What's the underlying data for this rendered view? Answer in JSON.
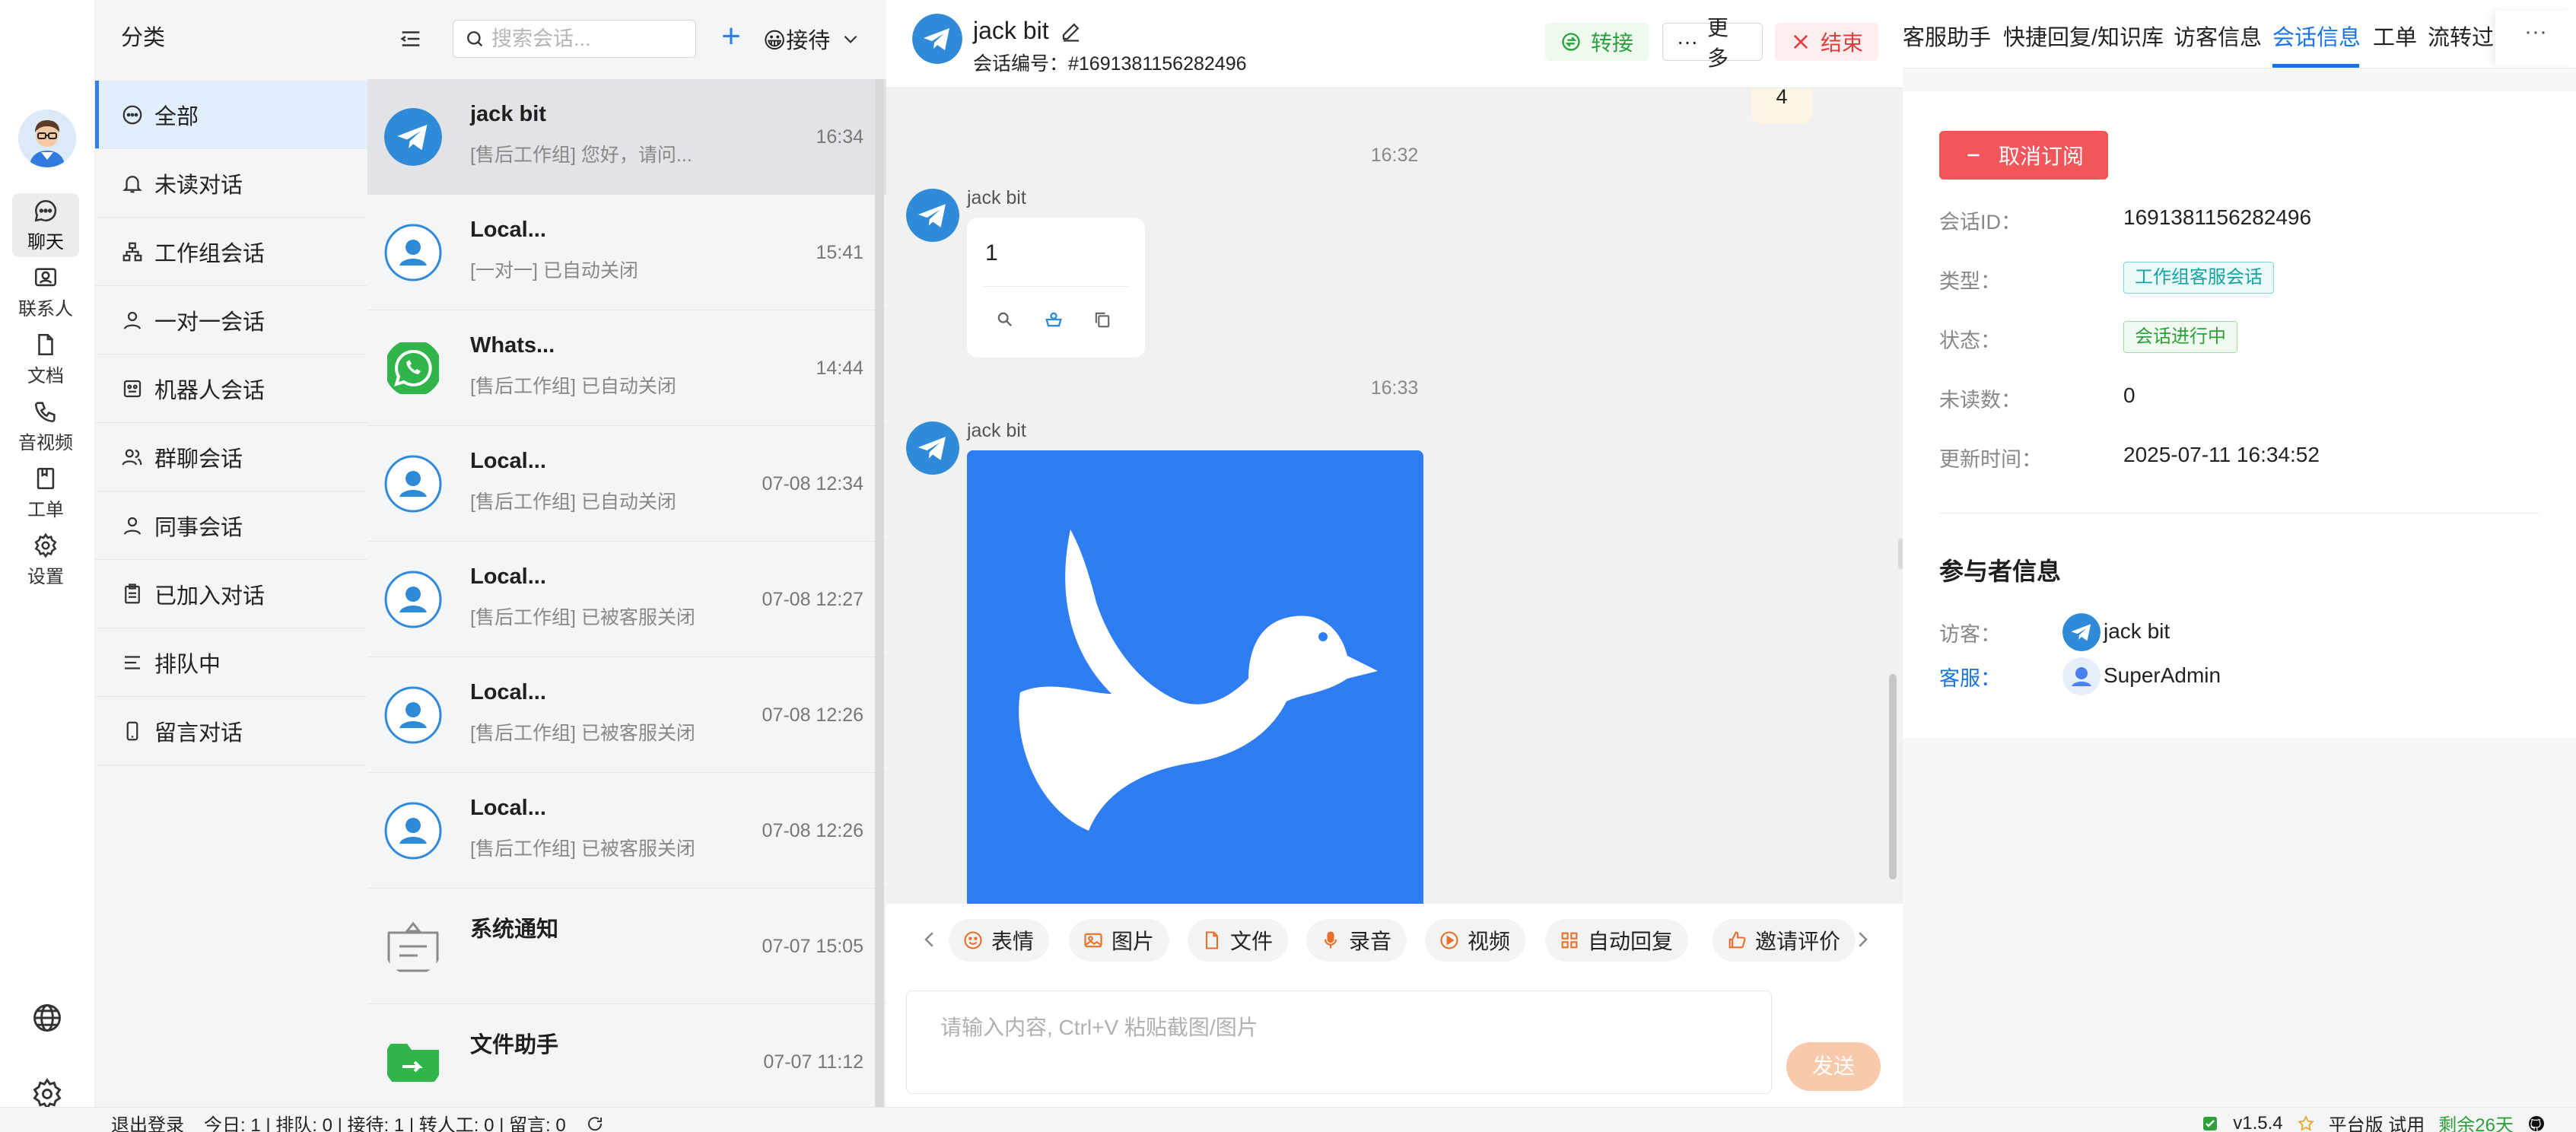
{
  "rail": {
    "items": [
      {
        "label": "聊天"
      },
      {
        "label": "联系人"
      },
      {
        "label": "文档"
      },
      {
        "label": "音视频"
      },
      {
        "label": "工单"
      },
      {
        "label": "设置"
      }
    ]
  },
  "category": {
    "title": "分类",
    "items": [
      {
        "label": "全部"
      },
      {
        "label": "未读对话"
      },
      {
        "label": "工作组会话"
      },
      {
        "label": "一对一会话"
      },
      {
        "label": "机器人会话"
      },
      {
        "label": "群聊会话"
      },
      {
        "label": "同事会话"
      },
      {
        "label": "已加入对话"
      },
      {
        "label": "排队中"
      },
      {
        "label": "留言对话"
      }
    ]
  },
  "conv_header": {
    "search_placeholder": "搜索会话...",
    "receive_label": "😀接待"
  },
  "conversations": [
    {
      "name": "jack bit",
      "preview": "[售后工作组] 您好，请问...",
      "time": "16:34",
      "avatar": "telegram-icon"
    },
    {
      "name": "Local...",
      "preview": "[一对一] 已自动关闭",
      "time": "15:41",
      "avatar": "user-icon"
    },
    {
      "name": "Whats...",
      "preview": "[售后工作组] 已自动关闭",
      "time": "14:44",
      "avatar": "whatsapp-icon"
    },
    {
      "name": "Local...",
      "preview": "[售后工作组] 已自动关闭",
      "time": "07-08 12:34",
      "avatar": "user-icon"
    },
    {
      "name": "Local...",
      "preview": "[售后工作组] 已被客服关闭",
      "time": "07-08 12:27",
      "avatar": "user-icon"
    },
    {
      "name": "Local...",
      "preview": "[售后工作组] 已被客服关闭",
      "time": "07-08 12:26",
      "avatar": "user-icon"
    },
    {
      "name": "Local...",
      "preview": "[售后工作组] 已被客服关闭",
      "time": "07-08 12:26",
      "avatar": "user-icon"
    },
    {
      "name": "系统通知",
      "preview": "",
      "time": "07-07 15:05",
      "avatar": "notice-icon"
    },
    {
      "name": "文件助手",
      "preview": "",
      "time": "07-07 11:12",
      "avatar": "folder-icon"
    }
  ],
  "chat": {
    "title": "jack bit",
    "subtitle": "会话编号：#1691381156282496",
    "transfer_label": "转接",
    "more_label": "更多",
    "end_label": "结束",
    "top_bubble_text": "4",
    "messages": [
      {
        "time": "16:32",
        "sender": "jack bit",
        "text": "1"
      },
      {
        "time": "16:33",
        "sender": "jack bit",
        "kind": "image"
      }
    ],
    "toolbar": [
      "表情",
      "图片",
      "文件",
      "录音",
      "视频",
      "自动回复",
      "邀请评价"
    ],
    "input_placeholder": "请输入内容, Ctrl+V 粘贴截图/图片",
    "send_label": "发送"
  },
  "right_panel": {
    "tabs": [
      "客服助手",
      "快捷回复/知识库",
      "访客信息",
      "会话信息",
      "工单",
      "流转过"
    ],
    "active_tab": "会话信息",
    "more_label": "···",
    "unsubscribe_label": "取消订阅",
    "fields": [
      {
        "label": "会话ID：",
        "value": "1691381156282496"
      },
      {
        "label": "类型：",
        "value": "工作组客服会话",
        "tag": "cyan"
      },
      {
        "label": "状态：",
        "value": "会话进行中",
        "tag": "green"
      },
      {
        "label": "未读数：",
        "value": "0"
      },
      {
        "label": "更新时间：",
        "value": "2025-07-11 16:34:52"
      }
    ],
    "participants_title": "参与者信息",
    "visitor_label": "访客：",
    "visitor_name": "jack bit",
    "agent_label": "客服：",
    "agent_name": "SuperAdmin"
  },
  "status_bar": {
    "logout": "退出登录",
    "stats": "今日: 1 | 排队: 0 | 接待: 1 | 转人工: 0 | 留言: 0",
    "version": "v1.5.4",
    "edition": "平台版 试用",
    "remaining": "剩余26天"
  },
  "colors": {
    "accent": "#1a73e8",
    "telegram": "#2f8bd8",
    "whatsapp": "#2fb54a",
    "danger": "#e23b3b",
    "success": "#2c9f3e"
  }
}
